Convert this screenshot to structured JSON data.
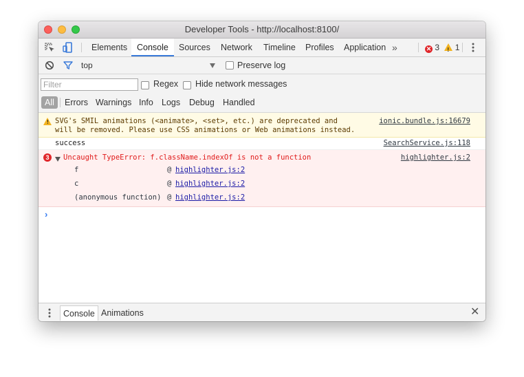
{
  "window": {
    "title": "Developer Tools - http://localhost:8100/"
  },
  "tabs": [
    "Elements",
    "Console",
    "Sources",
    "Network",
    "Timeline",
    "Profiles",
    "Application"
  ],
  "active_tab": "Console",
  "more_tabs": "»",
  "status": {
    "errors": "3",
    "warnings": "1"
  },
  "console_toolbar": {
    "context": "top",
    "preserve_log": "Preserve log"
  },
  "filter": {
    "placeholder": "Filter",
    "regex_label": "Regex",
    "hide_network_label": "Hide network messages",
    "levels": [
      "All",
      "Errors",
      "Warnings",
      "Info",
      "Logs",
      "Debug",
      "Handled"
    ]
  },
  "messages": {
    "warning": {
      "line1": "SVG's SMIL animations (<animate>, <set>, etc.) are deprecated and",
      "line2": "will be removed. Please use CSS animations or Web animations instead.",
      "source": "ionic.bundle.js:16679"
    },
    "log": {
      "text": "success",
      "source": "SearchService.js:118"
    },
    "error": {
      "count": "3",
      "text": "Uncaught TypeError: f.className.indexOf is not a function",
      "source": "highlighter.js:2",
      "stack": [
        {
          "fn": "f",
          "at": "@",
          "link": "highlighter.js:2"
        },
        {
          "fn": "c",
          "at": "@",
          "link": "highlighter.js:2"
        },
        {
          "fn": "(anonymous function)",
          "at": "@",
          "link": "highlighter.js:2"
        }
      ]
    },
    "prompt": "›"
  },
  "drawer": {
    "tabs": [
      "Console",
      "Animations"
    ],
    "active": "Console",
    "close": "✕"
  },
  "colors": {
    "accent": "#3879d9",
    "error": "#e01a1a",
    "warning_bg": "#fffbe5",
    "error_bg": "#fff0f0"
  }
}
